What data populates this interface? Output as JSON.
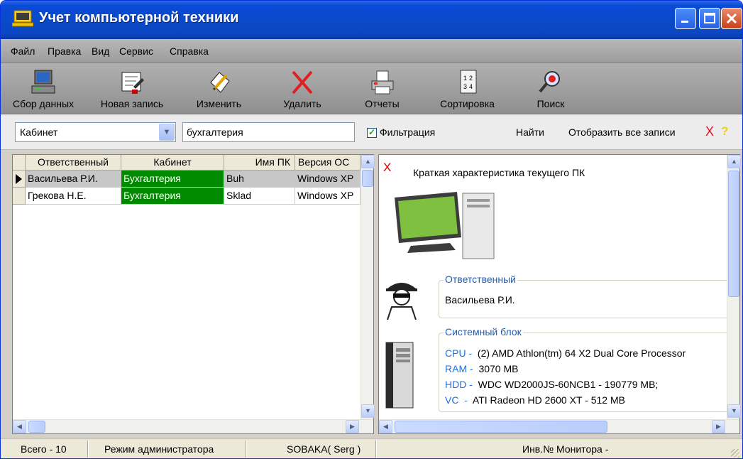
{
  "window": {
    "title": "Учет компьютерной техники"
  },
  "menu": {
    "items": [
      "Файл",
      "Правка",
      "Вид",
      "Сервис",
      "Справка"
    ]
  },
  "toolbar": {
    "collect": "Сбор данных",
    "new_record": "Новая запись",
    "edit": "Изменить",
    "delete": "Удалить",
    "reports": "Отчеты",
    "sort": "Сортировка",
    "search": "Поиск"
  },
  "filter": {
    "field_selected": "Кабинет",
    "value": "бухгалтерия",
    "checkbox_label": "Фильтрация",
    "checked": true,
    "find": "Найти",
    "show_all": "Отобразить все записи",
    "clear_mark": "X",
    "help_mark": "?"
  },
  "grid": {
    "columns": [
      "Ответственный",
      "Кабинет",
      "Имя ПК",
      "Версия ОС"
    ],
    "rows": [
      [
        "Васильева Р.И.",
        "Бухгалтерия",
        "Buh",
        "Windows XP"
      ],
      [
        "Грекова Н.Е.",
        "Бухгалтерия",
        "Sklad",
        "Windows XP"
      ]
    ],
    "highlight_color": "#008a00"
  },
  "details": {
    "close_mark": "X",
    "title": "Краткая характеристика текущего ПК",
    "responsible": {
      "label": "Ответственный",
      "value": "Васильева Р.И."
    },
    "system_unit": {
      "label": "Системный блок",
      "specs": [
        {
          "key": "CPU -",
          "value": "(2) AMD Athlon(tm) 64 X2 Dual Core Processor"
        },
        {
          "key": "RAM -",
          "value": "3070 MB"
        },
        {
          "key": "HDD -",
          "value": "WDC WD2000JS-60NCB1 - 190779 MB;"
        },
        {
          "key": "VC  -",
          "value": "ATI Radeon HD 2600 XT - 512 MB"
        }
      ]
    }
  },
  "status": {
    "total": "Всего - 10",
    "mode": "Режим администратора",
    "host": "SOBAKA( Serg )",
    "monitor": "Инв.№ Монитора -"
  }
}
